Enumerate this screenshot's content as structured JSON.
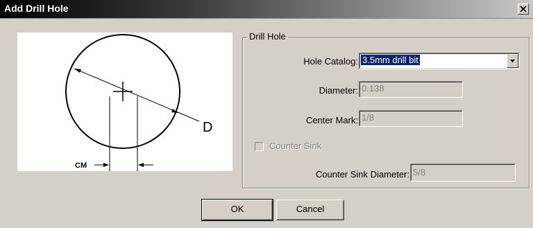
{
  "window": {
    "title": "Add Drill Hole",
    "close_icon": "close-icon"
  },
  "diagram": {
    "label_d": "D",
    "label_cm": "CM"
  },
  "group": {
    "legend": "Drill Hole",
    "hole_catalog_label": "Hole Catalog:",
    "hole_catalog_value": "3.5mm drill bit",
    "diameter_label": "Diameter:",
    "diameter_value": "0.138",
    "center_mark_label": "Center Mark:",
    "center_mark_value": "1/8",
    "counter_sink_label": "Counter Sink",
    "counter_sink_checked": false,
    "counter_sink_diameter_label": "Counter Sink Diameter:",
    "counter_sink_diameter_value": "5/8"
  },
  "buttons": {
    "ok": "OK",
    "cancel": "Cancel"
  }
}
